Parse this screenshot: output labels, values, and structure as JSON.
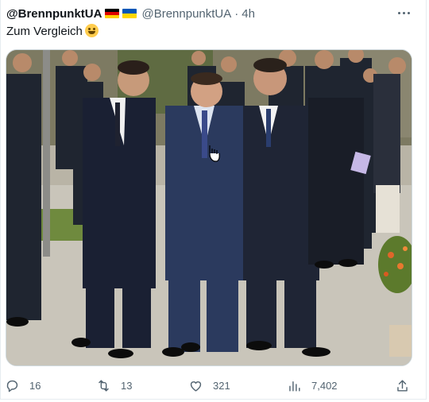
{
  "tweet": {
    "display_name": "@BrennpunktUA",
    "handle": "@BrennpunktUA",
    "separator": "·",
    "time": "4h",
    "text": "Zum Vergleich",
    "emoji": "laughing-with-tears-emoji",
    "flags": [
      "germany-flag",
      "ukraine-flag"
    ]
  },
  "media": {
    "icon": "photo-image"
  },
  "actions": {
    "replies": "16",
    "retweets": "13",
    "likes": "321",
    "views": "7,402"
  }
}
